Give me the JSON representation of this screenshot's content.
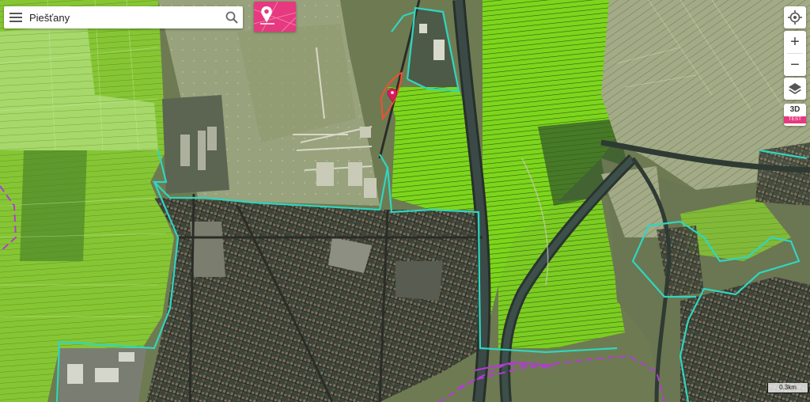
{
  "search": {
    "value": "Piešťany"
  },
  "controls": {
    "zoom_in": "+",
    "zoom_out": "−",
    "view_3d": "3D",
    "test_badge": "TEST"
  },
  "scale_bar": {
    "label": "0.3km"
  },
  "colors": {
    "boundary": "#2fd6c0",
    "marker": "#d81b60",
    "highlight_ring": "#ff4b2b",
    "district_dashed": "#b23bd6",
    "parcel_green": "#7dd61c",
    "accent": "#e6397f"
  },
  "icons": [
    "menu-icon",
    "search-icon",
    "map-pin-icon",
    "locate-icon",
    "layers-icon"
  ]
}
